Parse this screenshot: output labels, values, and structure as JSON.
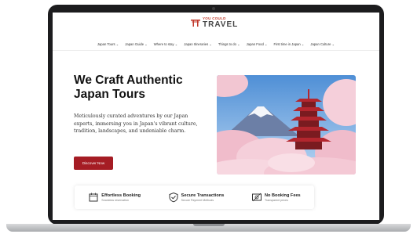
{
  "brand": {
    "logo_top": "YOU COULD",
    "logo_main": "TRAVEL"
  },
  "nav": {
    "items": [
      "Japan Tours",
      "Japan Guide",
      "Where to stay",
      "Japan Itineraries",
      "Things to do",
      "Japan Food",
      "First time in Japan",
      "Japan Culture"
    ]
  },
  "hero": {
    "headline": "We Craft Authentic Japan Tours",
    "description": "Meticulously curated adventures by our Japan experts, immersing you in Japan's vibrant culture, tradition, landscapes, and undeniable charm.",
    "cta_label": "Discover Now"
  },
  "features": [
    {
      "title": "Effortless Booking",
      "subtitle": "Seamless reservation",
      "icon": "booking-icon"
    },
    {
      "title": "Secure Transactions",
      "subtitle": "Secure Payment Methods",
      "icon": "shield-check-icon"
    },
    {
      "title": "No Booking Fees",
      "subtitle": "Transparent prices",
      "icon": "no-fee-icon"
    }
  ],
  "colors": {
    "accent": "#a51c24",
    "bezel": "#1c1c1e",
    "sky": "#6fa6e0",
    "blossom": "#f2c6d2",
    "pagoda": "#b3262e"
  }
}
